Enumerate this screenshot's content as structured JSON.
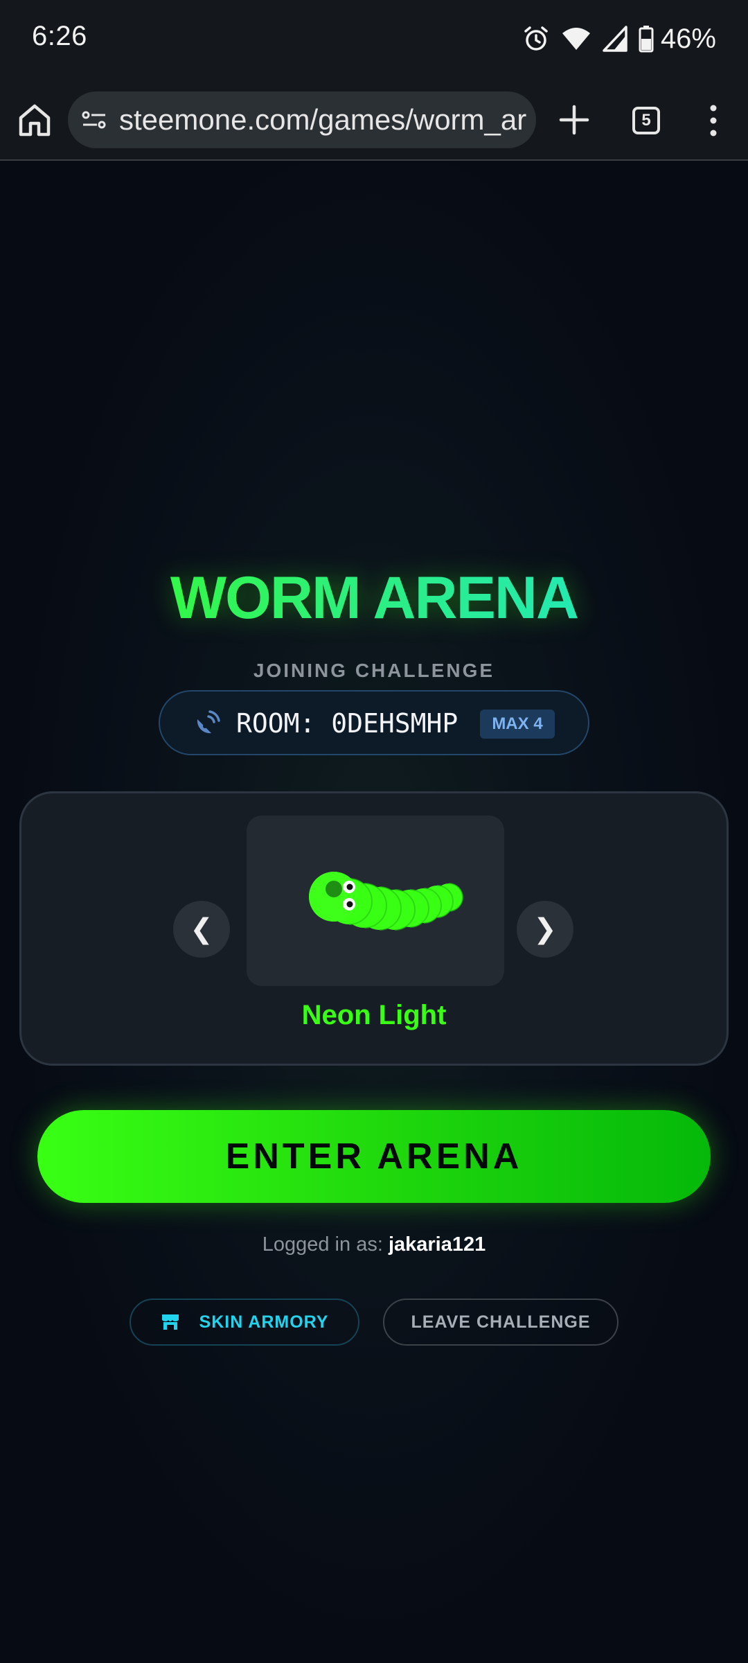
{
  "status_bar": {
    "time": "6:26",
    "battery_percent": "46%",
    "icons": [
      "alarm-icon",
      "wifi-icon",
      "cell-signal-icon",
      "battery-icon"
    ]
  },
  "browser": {
    "url": "steemone.com/games/worm_ar",
    "tab_count": "5",
    "icons": [
      "home-icon",
      "tune-icon",
      "plus-icon",
      "tabs-icon",
      "more-vert-icon"
    ]
  },
  "game": {
    "title": "WORM ARENA",
    "subtitle": "JOINING CHALLENGE",
    "room": {
      "label": "ROOM: 0DEHSMHP",
      "badge": "MAX 4"
    },
    "skin_selector": {
      "prev_label": "❮",
      "next_label": "❯",
      "skin_name": "Neon Light",
      "skin_color": "#39ff14"
    },
    "enter_button": "ENTER ARENA",
    "login": {
      "prefix": "Logged in as:",
      "username": "jakaria121"
    },
    "skin_armory_button": "SKIN ARMORY",
    "leave_button": "LEAVE CHALLENGE"
  },
  "colors": {
    "accent_green": "#39ff14",
    "accent_cyan": "#22d3ee",
    "background": "#070b14"
  }
}
